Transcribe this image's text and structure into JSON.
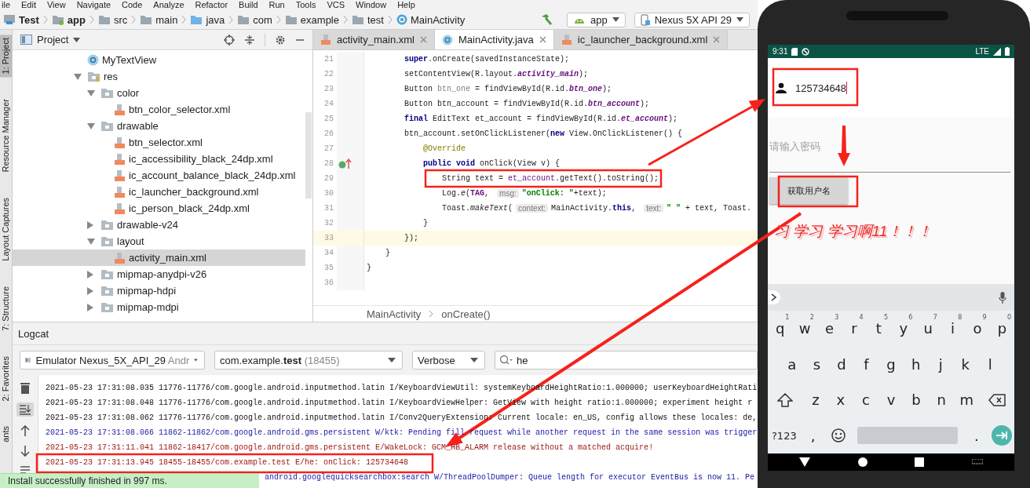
{
  "menu": [
    "ile",
    "Edit",
    "View",
    "Navigate",
    "Code",
    "Analyze",
    "Refactor",
    "Build",
    "Run",
    "Tools",
    "VCS",
    "Window",
    "Help"
  ],
  "breadcrumb": [
    {
      "label": "Test",
      "kind": "module"
    },
    {
      "label": "app",
      "kind": "app"
    },
    {
      "label": "src",
      "kind": "folder"
    },
    {
      "label": "main",
      "kind": "folder"
    },
    {
      "label": "java",
      "kind": "source"
    },
    {
      "label": "com",
      "kind": "folder"
    },
    {
      "label": "example",
      "kind": "folder"
    },
    {
      "label": "test",
      "kind": "folder"
    },
    {
      "label": "MainActivity",
      "kind": "class"
    }
  ],
  "run_config": "app",
  "device": "Nexus 5X API 29",
  "tool_tabs": [
    {
      "label": "1: Project",
      "selected": true
    },
    {
      "label": "Resource Manager",
      "selected": false
    },
    {
      "label": "Layout Captures",
      "selected": false
    },
    {
      "label": "7: Structure",
      "selected": false
    },
    {
      "label": "2: Favorites",
      "selected": false
    },
    {
      "label": "ants",
      "selected": false
    }
  ],
  "project": {
    "title": "Project",
    "tree": [
      {
        "name": "MyTextView",
        "kind": "class",
        "selected": false
      },
      {
        "name": "res",
        "kind": "res",
        "expanded": true,
        "selected": false,
        "children": [
          {
            "name": "color",
            "kind": "folder",
            "expanded": true,
            "selected": false,
            "children": [
              {
                "name": "btn_color_selector.xml",
                "kind": "xml",
                "selected": false
              }
            ]
          },
          {
            "name": "drawable",
            "kind": "folder",
            "expanded": true,
            "selected": false,
            "children": [
              {
                "name": "btn_selector.xml",
                "kind": "xml",
                "selected": false
              },
              {
                "name": "ic_accessibility_black_24dp.xml",
                "kind": "xml",
                "selected": false
              },
              {
                "name": "ic_account_balance_black_24dp.xml",
                "kind": "xml",
                "selected": false
              },
              {
                "name": "ic_launcher_background.xml",
                "kind": "xml",
                "selected": false
              },
              {
                "name": "ic_person_black_24dp.xml",
                "kind": "xml",
                "selected": false
              }
            ]
          },
          {
            "name": "drawable-v24",
            "kind": "folder",
            "expanded": false,
            "selected": false
          },
          {
            "name": "layout",
            "kind": "folder",
            "expanded": true,
            "selected": false,
            "children": [
              {
                "name": "activity_main.xml",
                "kind": "xml",
                "selected": true
              }
            ]
          },
          {
            "name": "mipmap-anydpi-v26",
            "kind": "folder",
            "expanded": false,
            "selected": false
          },
          {
            "name": "mipmap-hdpi",
            "kind": "folder",
            "expanded": false,
            "selected": false
          },
          {
            "name": "mipmap-mdpi",
            "kind": "folder",
            "expanded": false,
            "selected": false
          }
        ]
      }
    ]
  },
  "editor": {
    "tabs": [
      {
        "label": "activity_main.xml",
        "kind": "xml",
        "selected": false
      },
      {
        "label": "MainActivity.java",
        "kind": "class",
        "selected": true
      },
      {
        "label": "ic_launcher_background.xml",
        "kind": "xml",
        "selected": false
      }
    ],
    "lines": [
      {
        "number": "21",
        "current": false,
        "tokens": [
          {
            "kind": "keyword",
            "text": "        super"
          },
          {
            "kind": "plain",
            "text": ".onCreate(savedInstanceState);"
          }
        ]
      },
      {
        "number": "22",
        "current": false,
        "tokens": [
          {
            "kind": "plain",
            "text": "        setContentView(R.layout."
          },
          {
            "kind": "field",
            "text": "activity_main"
          },
          {
            "kind": "plain",
            "text": ");"
          }
        ]
      },
      {
        "number": "23",
        "current": false,
        "tokens": [
          {
            "kind": "plain",
            "text": "        Button "
          },
          {
            "kind": "unused",
            "text": "btn_one"
          },
          {
            "kind": "plain",
            "text": " = findViewById(R.id."
          },
          {
            "kind": "field",
            "text": "btn_one"
          },
          {
            "kind": "plain",
            "text": ");"
          }
        ]
      },
      {
        "number": "24",
        "current": false,
        "tokens": [
          {
            "kind": "plain",
            "text": "        Button btn_account = findViewById(R.id."
          },
          {
            "kind": "field",
            "text": "btn_account"
          },
          {
            "kind": "plain",
            "text": ");"
          }
        ]
      },
      {
        "number": "25",
        "current": false,
        "tokens": [
          {
            "kind": "keyword",
            "text": "        final"
          },
          {
            "kind": "plain",
            "text": " EditText et_account = findViewById(R.id."
          },
          {
            "kind": "field",
            "text": "et_account"
          },
          {
            "kind": "plain",
            "text": ");"
          }
        ]
      },
      {
        "number": "26",
        "current": false,
        "tokens": [
          {
            "kind": "plain",
            "text": "        btn_account.setOnClickListener("
          },
          {
            "kind": "keyword",
            "text": "new"
          },
          {
            "kind": "plain",
            "text": " View.OnClickListener() {"
          }
        ]
      },
      {
        "number": "27",
        "current": false,
        "tokens": [
          {
            "kind": "annotation",
            "text": "            @Override"
          }
        ]
      },
      {
        "number": "28",
        "current": false,
        "kind": "override",
        "tokens": [
          {
            "kind": "keyword",
            "text": "            public void"
          },
          {
            "kind": "plain",
            "text": " onClick(View v) {"
          }
        ]
      },
      {
        "number": "29",
        "current": false,
        "tokens": [
          {
            "kind": "plain",
            "text": "                String text = "
          },
          {
            "kind": "var",
            "text": "et_account"
          },
          {
            "kind": "plain",
            "text": ".getText().toString();"
          }
        ]
      },
      {
        "number": "30",
        "current": false,
        "tokens": [
          {
            "kind": "plain",
            "text": "                Log."
          },
          {
            "kind": "static",
            "text": "e"
          },
          {
            "kind": "plain",
            "text": "("
          },
          {
            "kind": "constant",
            "text": "TAG"
          },
          {
            "kind": "plain",
            "text": ", "
          },
          {
            "kind": "hint",
            "text": "msg:"
          },
          {
            "kind": "string",
            "text": "\"onClick: \""
          },
          {
            "kind": "plain",
            "text": "+text);"
          }
        ]
      },
      {
        "number": "31",
        "current": false,
        "tokens": [
          {
            "kind": "plain",
            "text": "                Toast."
          },
          {
            "kind": "static",
            "text": "makeText"
          },
          {
            "kind": "plain",
            "text": "("
          },
          {
            "kind": "hint",
            "text": "context:"
          },
          {
            "kind": "plain",
            "text": "MainActivity."
          },
          {
            "kind": "keyword",
            "text": "this"
          },
          {
            "kind": "plain",
            "text": ", "
          },
          {
            "kind": "hint",
            "text": "text:"
          },
          {
            "kind": "string",
            "text": "\" \""
          },
          {
            "kind": "plain",
            "text": " + text, Toast."
          }
        ]
      },
      {
        "number": "32",
        "current": false,
        "tokens": [
          {
            "kind": "plain",
            "text": "            }"
          }
        ]
      },
      {
        "number": "33",
        "current": true,
        "tokens": [
          {
            "kind": "plain",
            "text": "        });"
          }
        ]
      },
      {
        "number": "34",
        "current": false,
        "tokens": [
          {
            "kind": "plain",
            "text": "    }"
          }
        ]
      },
      {
        "number": "35",
        "current": false,
        "tokens": [
          {
            "kind": "plain",
            "text": "}"
          }
        ]
      },
      {
        "number": "36",
        "current": false
      }
    ],
    "path": [
      "MainActivity",
      "onCreate()"
    ]
  },
  "logcat": {
    "title": "Logcat",
    "device": {
      "name": "Emulator Nexus_5X_API_29",
      "suffix": "Andr"
    },
    "process": {
      "package": "com.example.",
      "app": "test",
      "pid": "(18455)"
    },
    "log_level_filter": "Verbose",
    "search": "he",
    "lines": [
      {
        "kind": "info",
        "cut_left": false,
        "text": "2021-05-23 17:31:08.035 11776-11776/com.google.android.inputmethod.latin I/KeyboardViewUtil: systemKeyboardHeightRatio:1.000000; userKeyboardHeightRati"
      },
      {
        "kind": "info",
        "cut_left": false,
        "text": "2021-05-23 17:31:08.048 11776-11776/com.google.android.inputmethod.latin I/KeyboardViewHelper: GetView with height ratio:1.000000; experiment height r"
      },
      {
        "kind": "info",
        "cut_left": false,
        "text": "2021-05-23 17:31:08.062 11776-11776/com.google.android.inputmethod.latin I/Conv2QueryExtension: Current locale: en_US, config allows these locales: de,"
      },
      {
        "kind": "warn",
        "cut_left": false,
        "text": "2021-05-23 17:31:08.066 11862-11862/com.google.android.gms.persistent W/ktk: Pending fill request while another request in the same session was trigger"
      },
      {
        "kind": "error",
        "cut_left": false,
        "text": "2021-05-23 17:31:11.041 11862-18417/com.google.android.gms.persistent E/WakeLock: GCM_HB_ALARM release without a matched acquire!"
      },
      {
        "kind": "error",
        "cut_left": false,
        "text": "2021-05-23 17:31:13.945 18455-18455/com.example.test E/he: onClick: 125734648"
      },
      {
        "kind": "warn",
        "cut_left": true,
        "text": "android.googlequicksearchbox:search W/ThreadPoolDumper: Queue length for executor EventBus is now 11. Pe"
      }
    ]
  },
  "toast": "Install successfully finished in 997 ms.",
  "phone": {
    "time": "9:31",
    "network": "LTE",
    "account": "125734648",
    "password_placeholder": "请输入密码",
    "button": "获取用户名",
    "message": "习 学习 学习啊11！！！",
    "keyboard": [
      [
        {
          "kind": "letter",
          "label": "q",
          "hint": "1"
        },
        {
          "kind": "letter",
          "label": "w",
          "hint": "2"
        },
        {
          "kind": "letter",
          "label": "e",
          "hint": "3"
        },
        {
          "kind": "letter",
          "label": "r",
          "hint": "4"
        },
        {
          "kind": "letter",
          "label": "t",
          "hint": "5"
        },
        {
          "kind": "letter",
          "label": "y",
          "hint": "6"
        },
        {
          "kind": "letter",
          "label": "u",
          "hint": "7"
        },
        {
          "kind": "letter",
          "label": "i",
          "hint": "8"
        },
        {
          "kind": "letter",
          "label": "o",
          "hint": "9"
        },
        {
          "kind": "letter",
          "label": "p",
          "hint": "0"
        }
      ],
      [
        {
          "kind": "letter",
          "label": "a"
        },
        {
          "kind": "letter",
          "label": "s"
        },
        {
          "kind": "letter",
          "label": "d"
        },
        {
          "kind": "letter",
          "label": "f"
        },
        {
          "kind": "letter",
          "label": "g"
        },
        {
          "kind": "letter",
          "label": "h"
        },
        {
          "kind": "letter",
          "label": "j"
        },
        {
          "kind": "letter",
          "label": "k"
        },
        {
          "kind": "letter",
          "label": "l"
        }
      ],
      [
        {
          "kind": "shift"
        },
        {
          "kind": "letter",
          "label": "z"
        },
        {
          "kind": "letter",
          "label": "x"
        },
        {
          "kind": "letter",
          "label": "c"
        },
        {
          "kind": "letter",
          "label": "v"
        },
        {
          "kind": "letter",
          "label": "b"
        },
        {
          "kind": "letter",
          "label": "n"
        },
        {
          "kind": "letter",
          "label": "m"
        },
        {
          "kind": "backspace"
        }
      ],
      [
        {
          "kind": "symbols",
          "label": "?123"
        },
        {
          "kind": "letter",
          "label": ","
        },
        {
          "kind": "emoji"
        },
        {
          "kind": "space"
        },
        {
          "kind": "letter",
          "label": "."
        },
        {
          "kind": "enter"
        }
      ]
    ]
  }
}
